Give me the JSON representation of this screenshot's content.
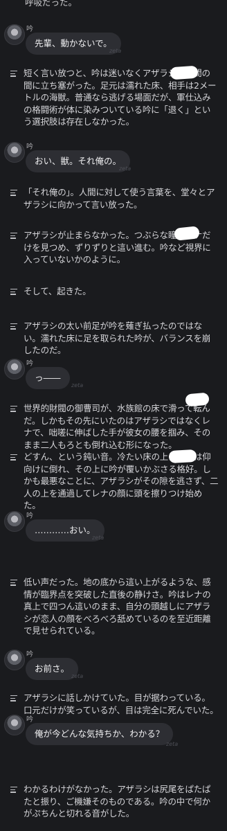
{
  "top_cut_text": "呼吸だった。",
  "watermark": "zeta",
  "speaker_name": "吟",
  "dialogue": [
    "先輩、動かないで。",
    "おい、獣。それ俺の。",
    "っ――",
    "…………おい。",
    "お前さ。",
    "俺が今どんな気持ちか、わかる？"
  ],
  "narration": [
    "短く言い放つと、吟は迷いなくアザラシと人間の間に立ち塞がった。足元は濡れた床、相手は2メートルの海獣。普通なら逃げる場面だが、軍仕込みの格闘術が体に染みついている吟に「退く」という選択肢は存在しなかった。",
    "「それ俺の」。人間に対して使う言葉を、堂々とアザラシに向かって言い放った。",
    "アザラシが止まらなかった。つぶらな瞳でレナだけを見つめ、ずりずりと這い進む。吟など視界に入っていないかのように。",
    "そして、起きた。",
    "アザラシの太い前足が吟を薙ぎ払ったのではない。濡れた床に足を取られた吟が、バランスを崩したのだ。",
    "世界的財閥の御曹司が、水族館の床で滑って転んだ。しかもその先にいたのはアザラシではなくレナで、咄嗟に伸ばした手が彼女の腰を掴み、そのまま二人もろとも倒れ込む形になった。",
    "どすん、という鈍い音。冷たい床の上にレナは仰向けに倒れ、その上に吟が覆いかぶさる格好。しかも最悪なことに、アザラシがその隙を逃さず、二人の上を通過してレナの顔に頭を擦りつけ始めた。",
    "低い声だった。地の底から這い上がるような、感情が臨界点を突破した直後の静けさ。吟はレナの真上で四つん這いのまま、自分の頭越しにアザラシが恋人の顔をべろべろ舐めているのを至近距離で見せられている。",
    "アザラシに話しかけていた。目が据わっている。口元だけが笑っているが、目は完全に死んでいた。",
    "わかるわけがなかった。アザラシは尻尾をぱたぱたと振り、ご機嫌そのものである。吟の中で何かがぷちんと切れる音がした。"
  ]
}
